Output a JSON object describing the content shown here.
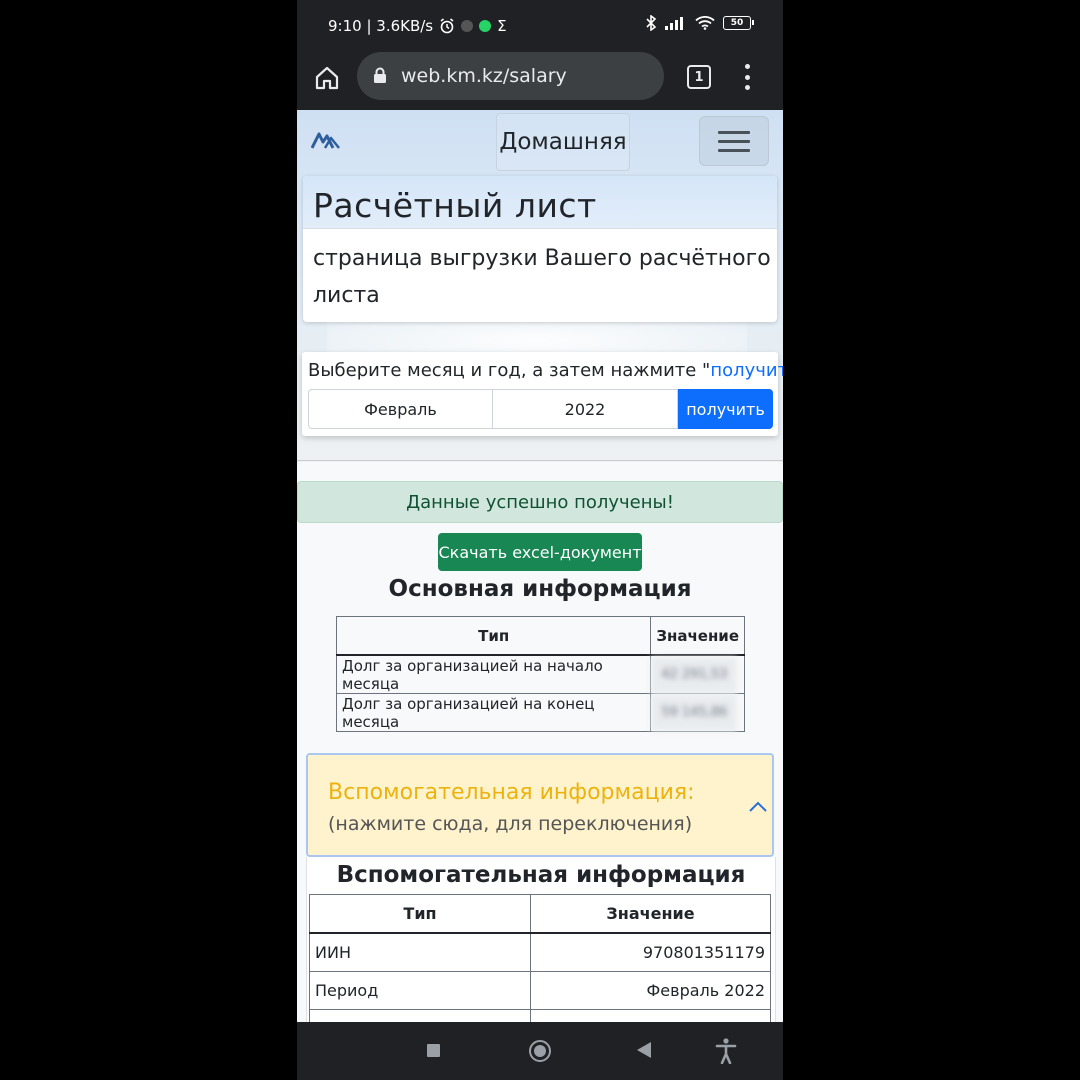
{
  "status_bar": {
    "time_speed": "9:10 | 3.6KB/s",
    "sigma": "Σ",
    "battery": "50"
  },
  "browser": {
    "url": "web.km.kz/salary",
    "tab_count": "1"
  },
  "nav": {
    "logo_text": "KM",
    "home_label": "Домашняя"
  },
  "header_card": {
    "title": "Расчётный лист",
    "subtitle": "страница выгрузки Вашего расчётного листа"
  },
  "selector": {
    "instruction_prefix": "Выберите месяц и год, а затем нажмите \"",
    "instruction_link": "получить",
    "instruction_suffix": "\"",
    "month": "Февраль",
    "year": "2022",
    "submit_label": "получить"
  },
  "alert": {
    "text": "Данные успешно получены!"
  },
  "download_button": "Скачать excel-документ",
  "main_info": {
    "heading": "Основная информация",
    "columns": [
      "Тип",
      "Значение"
    ],
    "rows": [
      {
        "type": "Долг за организацией на начало месяца",
        "value": "42 291,53"
      },
      {
        "type": "Долг за организацией на конец месяца",
        "value": "59 145,86"
      }
    ]
  },
  "aux_accordion": {
    "title": "Вспомогательная информация:",
    "hint": "(нажмите сюда, для переключения)"
  },
  "aux_info": {
    "heading": "Вспомогательная информация",
    "columns": [
      "Тип",
      "Значение"
    ],
    "rows": [
      {
        "type": "ИИН",
        "value": "970801351179"
      },
      {
        "type": "Период",
        "value": "Февраль 2022"
      }
    ]
  },
  "colors": {
    "primary": "#0d6efd",
    "success": "#198754",
    "alert_bg": "#d1e7dd",
    "warning_text": "#ecb30e"
  }
}
